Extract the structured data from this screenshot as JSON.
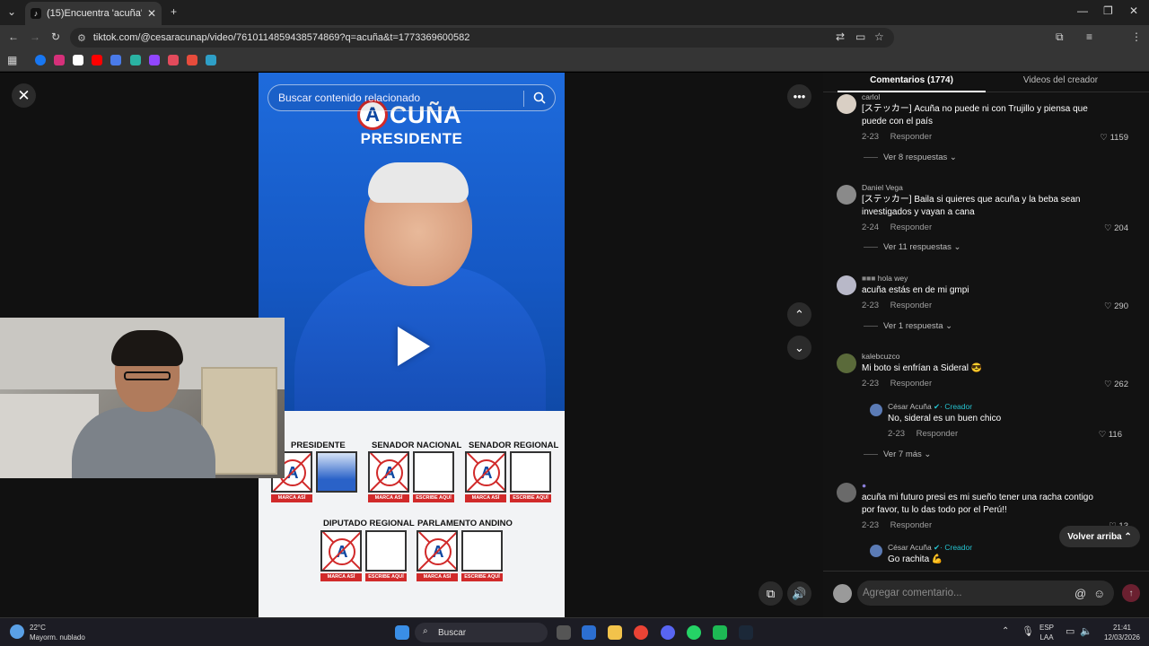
{
  "browser": {
    "tab_title": "(15)Encuentra 'acuña' en TikTo...",
    "url": "tiktok.com/@cesaracunap/video/7610114859438574869?q=acuña&t=1773369600582"
  },
  "video": {
    "search_placeholder": "Buscar contenido relacionado",
    "logo_letter": "A",
    "logo_word": "CUÑA",
    "headline": "PRESIDENTE",
    "ballot": {
      "presidente": "PRESIDENTE",
      "senador_nacional": "SENADOR NACIONAL",
      "senador_regional": "SENADOR REGIONAL",
      "diputado_regional": "DIPUTADO REGIONAL",
      "parlamento_andino": "PARLAMENTO ANDINO",
      "marca_asi": "MARCA ASÍ",
      "escribe_aqui": "ESCRIBE AQUÍ"
    }
  },
  "panel": {
    "tab_comments": "Comentarios (1774)",
    "tab_videos": "Videos del creador",
    "comments": [
      {
        "user": "carlol",
        "text": "[ステッカー] Acuña no puede ni con Trujillo y piensa que puede con el país",
        "date": "2-23",
        "reply_label": "Responder",
        "likes": "1159",
        "replies": "Ver 8 respuestas ⌄"
      },
      {
        "user": "Daniel Vega",
        "text": "[ステッカー] Baila si quieres que acuña y la beba sean investigados y vayan a cana",
        "date": "2-24",
        "reply_label": "Responder",
        "likes": "204",
        "replies": "Ver 11 respuestas ⌄"
      },
      {
        "user": "hola wey",
        "text": "acuña estás en de mi gmpi",
        "date": "2-23",
        "reply_label": "Responder",
        "likes": "290",
        "replies": "Ver 1 respuesta ⌄"
      },
      {
        "user": "kalebcuzco",
        "text": "Mi boto si enfrían a Sideral 😎",
        "date": "2-23",
        "reply_label": "Responder",
        "likes": "262",
        "replies": "Ver 7 más ⌄"
      },
      {
        "user": "",
        "text": "acuña mi futuro presi es mi sueño tener una racha contigo por favor, tu lo das todo por el Perú!!",
        "date": "2-23",
        "reply_label": "Responder",
        "likes": "13"
      }
    ],
    "creator_reply_1": {
      "user": "César Acuña",
      "badge": "· Creador",
      "text": "No, sideral es un buen chico",
      "date": "2-23",
      "reply_label": "Responder",
      "likes": "116"
    },
    "creator_reply_2": {
      "user": "César Acuña",
      "badge": "· Creador",
      "text": "Go rachita 💪"
    },
    "back_to_top": "Volver arriba ⌃",
    "composer_placeholder": "Agregar comentario..."
  },
  "taskbar": {
    "temp": "22°C",
    "weather": "Mayorm. nublado",
    "search": "Buscar",
    "lang1": "ESP",
    "lang2": "LAA",
    "time": "21:41",
    "date": "12/03/2026"
  }
}
